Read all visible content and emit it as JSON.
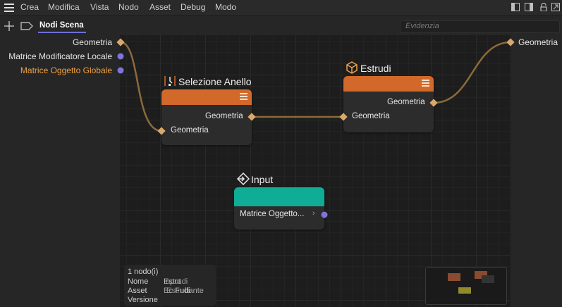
{
  "menu": {
    "items": [
      "Crea",
      "Modifica",
      "Vista",
      "Nodo",
      "Asset",
      "Debug",
      "Modo"
    ]
  },
  "tabs": {
    "active_label": "Nodi Scena"
  },
  "search": {
    "placeholder": "Evidenzia"
  },
  "left_ports": {
    "items": [
      {
        "label": "Geometria",
        "type": "geometry"
      },
      {
        "label": "Matrice Modificatore Locale",
        "type": "matrix"
      },
      {
        "label": "Matrice Oggetto Globale",
        "type": "matrix",
        "highlighted": true
      }
    ]
  },
  "right_ports": {
    "items": [
      {
        "label": "Geometria",
        "type": "geometry"
      }
    ]
  },
  "nodes": {
    "selezione": {
      "title": "Selezione Anello",
      "output_label": "Geometria",
      "input_label": "Geometria",
      "header_color": "#d2692a"
    },
    "estrudi": {
      "title": "Estrudi",
      "output_label": "Geometria",
      "input_label": "Geometria",
      "header_color": "#d2692a"
    },
    "input": {
      "title": "Input",
      "output_label": "Matrice Oggetto...",
      "header_color": "#0fac96"
    }
  },
  "info": {
    "count": "1 nodo(i)",
    "name_label": "Nome",
    "name_value_a": "Input",
    "name_value_b": "Estrudi",
    "asset_label": "Asset",
    "asset_value_a": "Ec Fudi",
    "asset_value_b": "Estrudi",
    "asset_value_c": "ltante",
    "version_label": "Versione"
  },
  "colors": {
    "geometry_port": "#d9a86a",
    "matrix_port": "#7e74d9",
    "wire": "#8a6a3e",
    "highlight_text": "#f0a040",
    "tab_underline": "#6e6fd6"
  }
}
